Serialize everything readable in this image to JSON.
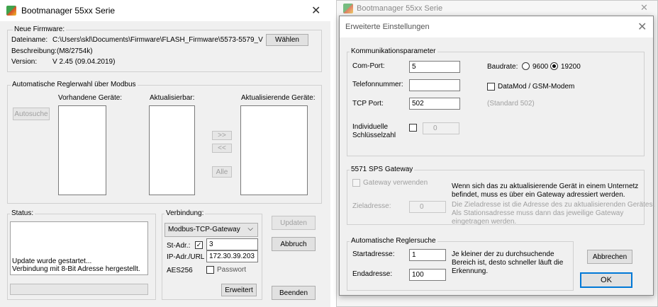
{
  "main": {
    "title": "Bootmanager 55xx Serie",
    "firmware": {
      "legend": "Neue Firmware:",
      "filename_label": "Dateiname:",
      "filename": "C:\\Users\\skl\\Documents\\Firmware\\FLASH_Firmware\\5573-5579_V",
      "description_label": "Beschreibung:",
      "description": "(M8/2754k)",
      "version_label": "Version:",
      "version": "V 2.45 (09.04.2019)",
      "choose_button": "Wählen"
    },
    "auto": {
      "legend": "Automatische Reglerwahl über Modbus",
      "search_button": "Autosuche",
      "available_label": "Vorhandene Geräte:",
      "updatable_label": "Aktualisierbar:",
      "updating_label": "Aktualisierende Geräte:",
      "add_button": ">>",
      "remove_button": "<<",
      "all_button": "Alle"
    },
    "status": {
      "legend": "Status:",
      "line1": "Update wurde gestartet...",
      "line2": "Verbindung mit 8-Bit Adresse hergestellt.",
      "progress": 0
    },
    "connection": {
      "legend": "Verbindung:",
      "type": "Modbus-TCP-Gateway",
      "st_label": "St-Adr.:",
      "st_checked": true,
      "st_value": "3",
      "ip_label": "IP-Adr./URL",
      "ip_value": "172.30.39.203",
      "aes_label": "AES256",
      "password_label": "Passwort",
      "extended_button": "Erweitert"
    },
    "buttons": {
      "update": "Updaten",
      "abort": "Abbruch",
      "exit": "Beenden"
    }
  },
  "second": {
    "title": "Bootmanager 55xx Serie"
  },
  "dialog": {
    "title": "Erweiterte Einstellungen",
    "comm": {
      "legend": "Kommunikationsparameter",
      "com_label": "Com-Port:",
      "com_value": "5",
      "baud_label": "Baudrate:",
      "baud_9600": "9600",
      "baud_19200": "19200",
      "baud_selected": "19200",
      "phone_label": "Telefonnummer:",
      "phone_value": "",
      "datamod_label": "DataMod / GSM-Modem",
      "tcp_label": "TCP Port:",
      "tcp_value": "502",
      "tcp_hint": "(Standard 502)",
      "key_label1": "Individuelle",
      "key_label2": "Schlüsselzahl",
      "key_value": "0"
    },
    "gateway": {
      "legend": "5571 SPS Gateway",
      "use_label": "Gateway verwenden",
      "note1": "Wenn sich das zu aktualisierende Gerät in einem Unternetz",
      "note2": "befindet, muss es über ein Gateway adressiert werden.",
      "target_label": "Zieladresse:",
      "target_value": "0",
      "hint1": "Die Zieladresse ist die Adresse des zu aktualisierenden Gerätes.",
      "hint2": "Als Stationsadresse muss dann das jeweilige Gateway",
      "hint3": "eingetragen werden."
    },
    "search": {
      "legend": "Automatische Reglersuche",
      "start_label": "Startadresse:",
      "start_value": "1",
      "end_label": "Endadresse:",
      "end_value": "100",
      "note1": "Je kleiner der zu durchsuchende",
      "note2": "Bereich ist, desto schneller läuft die",
      "note3": "Erkennung."
    },
    "cancel_button": "Abbrechen",
    "ok_button": "OK"
  }
}
